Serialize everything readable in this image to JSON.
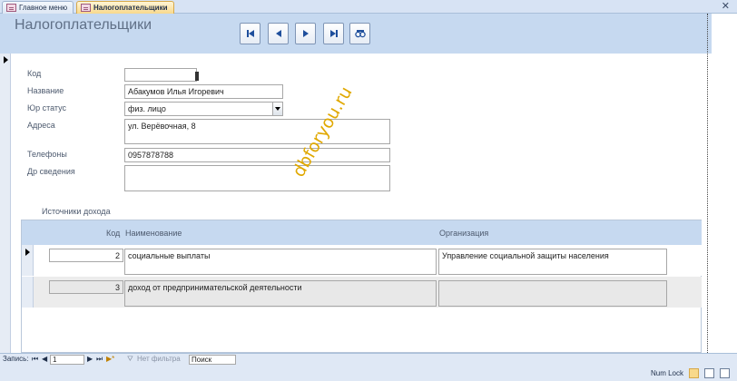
{
  "tabs": [
    {
      "label": "Главное меню",
      "active": false
    },
    {
      "label": "Налогоплательщики",
      "active": true
    }
  ],
  "form": {
    "title": "Налогоплательщики",
    "fields": {
      "kod": {
        "label": "Код",
        "value": ""
      },
      "name": {
        "label": "Название",
        "value": "Абакумов Илья Игоревич"
      },
      "status": {
        "label": "Юр статус",
        "value": "физ. лицо"
      },
      "address": {
        "label": "Адреса",
        "value": "ул. Верёвочная, 8"
      },
      "phones": {
        "label": "Телефоны",
        "value": "0957878788"
      },
      "other": {
        "label": "Др сведения",
        "value": ""
      }
    }
  },
  "watermark": "dbforyou.ru",
  "subform": {
    "caption": "Источники дохода",
    "headers": {
      "kod": "Код",
      "name": "Наименование",
      "org": "Организация"
    },
    "rows": [
      {
        "kod": "2",
        "name": "социальные выплаты",
        "org": "Управление социальной защиты населения"
      },
      {
        "kod": "3",
        "name": "доход от предпринимательской деятельности",
        "org": ""
      }
    ]
  },
  "statusbar": {
    "record_label": "Запись:",
    "record_value": "1",
    "filter_label": "Нет фильтра",
    "search_label": "Поиск",
    "numlock": "Num Lock"
  },
  "colors": {
    "header": "#c6d9f0",
    "active_tab": "#f8d98c",
    "watermark": "#e0a800"
  },
  "icons": [
    "first-record-icon",
    "prev-record-icon",
    "next-record-icon",
    "last-record-icon",
    "find-icon"
  ]
}
